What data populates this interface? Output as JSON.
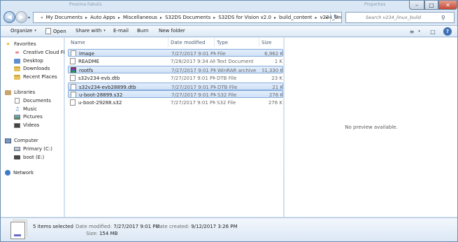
{
  "window": {
    "ghost_title_left": "Proxima Fabulis",
    "ghost_title_right": "Properties",
    "controls": {
      "minimize": "–",
      "maximize": "□",
      "close": "✕"
    }
  },
  "nav": {
    "back_glyph": "◀",
    "forward_glyph": "▶",
    "dropdown_glyph": "▾",
    "breadcrumbs": [
      "My Documents",
      "Auto Apps",
      "Miscellaneous",
      "S32DS Documents",
      "S32DS for Vision v2.0",
      "build_content",
      "v234_linux_build"
    ],
    "first_sep": "«",
    "sep": "▸",
    "address_dropdown": "▾",
    "refresh_glyph": "↻",
    "search_placeholder": "Search v234_linux_build",
    "search_icon": "search-icon"
  },
  "toolbar": {
    "organize": "Organize",
    "open": "Open",
    "share_with": "Share with",
    "email": "E-mail",
    "burn": "Burn",
    "new_folder": "New folder",
    "caret": "▾",
    "view_glyph": "≡",
    "preview_glyph": "□",
    "help_glyph": "?"
  },
  "sidebar": {
    "favorites": "Favorites",
    "favorite_items": [
      "Creative Cloud Files",
      "Desktop",
      "Downloads",
      "Recent Places"
    ],
    "libraries": "Libraries",
    "library_items": [
      "Documents",
      "Music",
      "Pictures",
      "Videos"
    ],
    "computer": "Computer",
    "computer_items": [
      "Primary (C:)",
      "boot (E:)"
    ],
    "network": "Network"
  },
  "columns": {
    "name": "Name",
    "date": "Date modified",
    "type": "Type",
    "size": "Size"
  },
  "files": [
    {
      "name": "Image",
      "date": "7/27/2017 9:01 PM",
      "type": "File",
      "size": "6,962 K",
      "selected": true,
      "icon": "file-icon"
    },
    {
      "name": "README",
      "date": "7/28/2017 9:34 AM",
      "type": "Text Document",
      "size": "1 K",
      "selected": false,
      "icon": "text-file-icon"
    },
    {
      "name": "rootfs",
      "date": "7/27/2017 9:01 PM",
      "type": "WinRAR archive",
      "size": "151,330 K",
      "selected": true,
      "icon": "winrar-icon"
    },
    {
      "name": "s32v234-evb.dtb",
      "date": "7/27/2017 9:01 PM",
      "type": "DTB File",
      "size": "23 K",
      "selected": false,
      "icon": "file-icon"
    },
    {
      "name": "s32v234-evb28899.dtb",
      "date": "7/27/2017 9:01 PM",
      "type": "DTB File",
      "size": "21 K",
      "selected": true,
      "icon": "file-icon"
    },
    {
      "name": "u-boot-28899.s32",
      "date": "7/27/2017 9:01 PM",
      "type": "S32 File",
      "size": "276 K",
      "selected": true,
      "icon": "file-icon"
    },
    {
      "name": "u-boot-29288.s32",
      "date": "7/27/2017 9:01 PM",
      "type": "S32 File",
      "size": "276 K",
      "selected": false,
      "icon": "file-icon"
    }
  ],
  "preview": {
    "message": "No preview available."
  },
  "details": {
    "count": "5 items selected",
    "date_modified_label": "Date modified:",
    "date_modified": "7/27/2017 9:01 PM",
    "date_created_label": "Date created:",
    "date_created": "9/12/2017 3:26 PM",
    "size_label": "Size:",
    "size": "154 MB"
  }
}
